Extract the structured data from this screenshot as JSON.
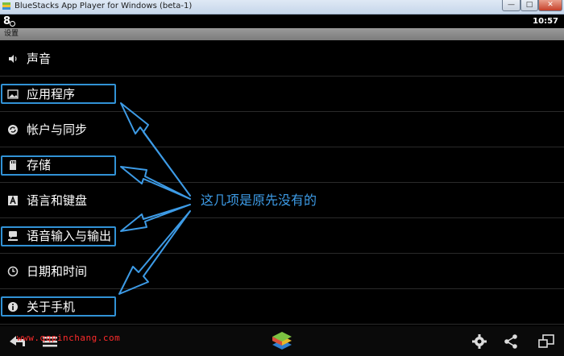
{
  "window": {
    "title": "BlueStacks App Player for Windows (beta-1)",
    "minimize": "—",
    "maximize": "□",
    "close": "✕"
  },
  "statusbar": {
    "logo": "8",
    "clock": "10:57"
  },
  "subbar": {
    "title": "设置"
  },
  "settings": {
    "items": [
      {
        "label": "声音",
        "icon": "volume-icon"
      },
      {
        "label": "应用程序",
        "icon": "apps-icon"
      },
      {
        "label": "帐户与同步",
        "icon": "sync-icon"
      },
      {
        "label": "存储",
        "icon": "sd-card-icon"
      },
      {
        "label": "语言和键盘",
        "icon": "keyboard-a-icon"
      },
      {
        "label": "语音输入与输出",
        "icon": "speech-icon"
      },
      {
        "label": "日期和时间",
        "icon": "clock-icon"
      },
      {
        "label": "关于手机",
        "icon": "info-icon"
      }
    ]
  },
  "annotation": {
    "text": "这几项是原先没有的",
    "color": "#3d9be6"
  },
  "watermark": {
    "text": "www.qqpinchang.com",
    "color": "#ff2b2b"
  },
  "navbar": {
    "buttons": [
      "back-icon",
      "menu-icon",
      "bluestacks-logo-icon",
      "settings-gear-icon",
      "share-icon",
      "window-switch-icon"
    ]
  }
}
